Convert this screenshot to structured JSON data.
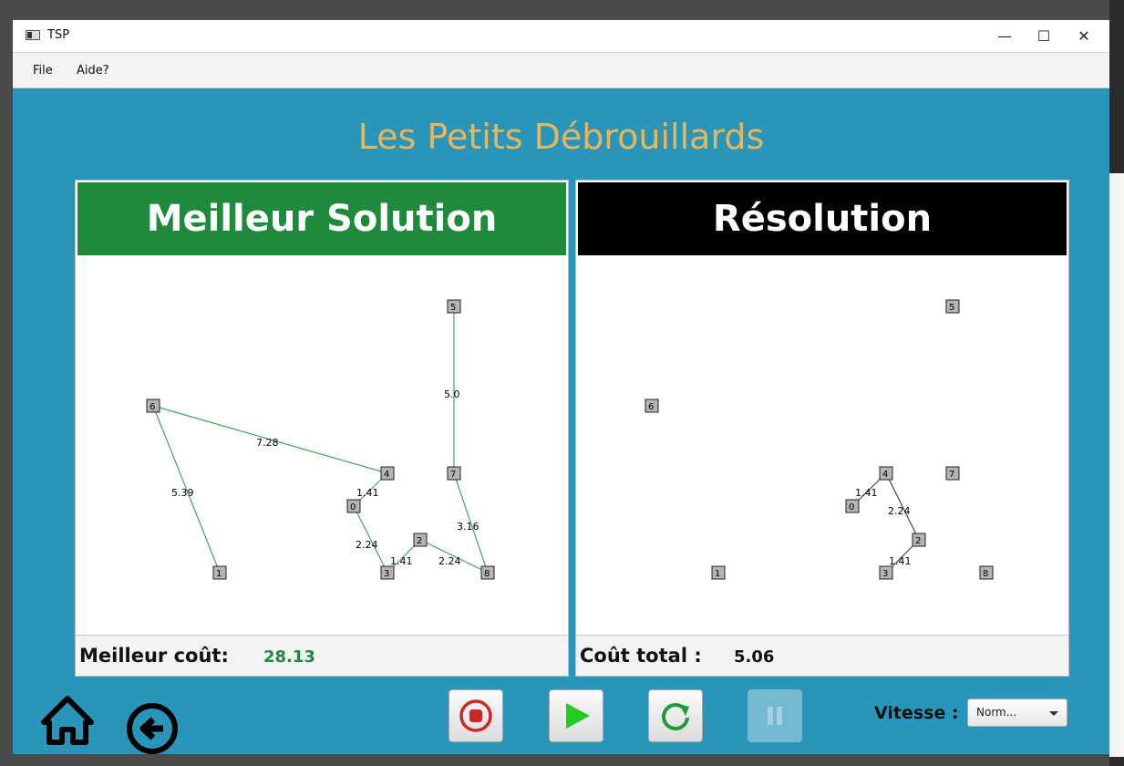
{
  "window": {
    "title": "TSP",
    "minimize_glyph": "—",
    "maximize_glyph": "☐",
    "close_glyph": "✕"
  },
  "menu": {
    "file": "File",
    "help": "Aide?"
  },
  "heading": "Les Petits Débrouillards",
  "best_panel": {
    "title": "Meilleur Solution",
    "cost_label": "Meilleur coût:",
    "cost_value": "28.13",
    "nodes": [
      "0",
      "1",
      "2",
      "3",
      "4",
      "5",
      "6",
      "7",
      "8"
    ],
    "edge_labels": [
      "5.0",
      "7.28",
      "5.39",
      "1.41",
      "2.24",
      "1.41",
      "2.24",
      "3.16"
    ]
  },
  "resolution_panel": {
    "title": "Résolution",
    "cost_label": "Coût total :",
    "cost_value": "5.06",
    "nodes": [
      "0",
      "1",
      "2",
      "3",
      "4",
      "5",
      "6",
      "7",
      "8"
    ],
    "edge_labels": [
      "1.41",
      "2.24",
      "1.41"
    ]
  },
  "controls": {
    "stop_icon": "stop-icon",
    "play_icon": "play-icon",
    "refresh_icon": "refresh-icon",
    "pause_icon": "pause-icon",
    "home_icon": "home-icon",
    "back_icon": "back-arrow-icon",
    "speed_label": "Vitesse :",
    "speed_value": "Norm..."
  },
  "colors": {
    "background": "#2a95bb",
    "heading": "#e8b65a",
    "best_header": "#1f8a3b",
    "resolution_header": "#000000",
    "best_cost": "#1f8a3b",
    "best_edges": "#3aaa57",
    "resolution_edges": "#444444"
  }
}
